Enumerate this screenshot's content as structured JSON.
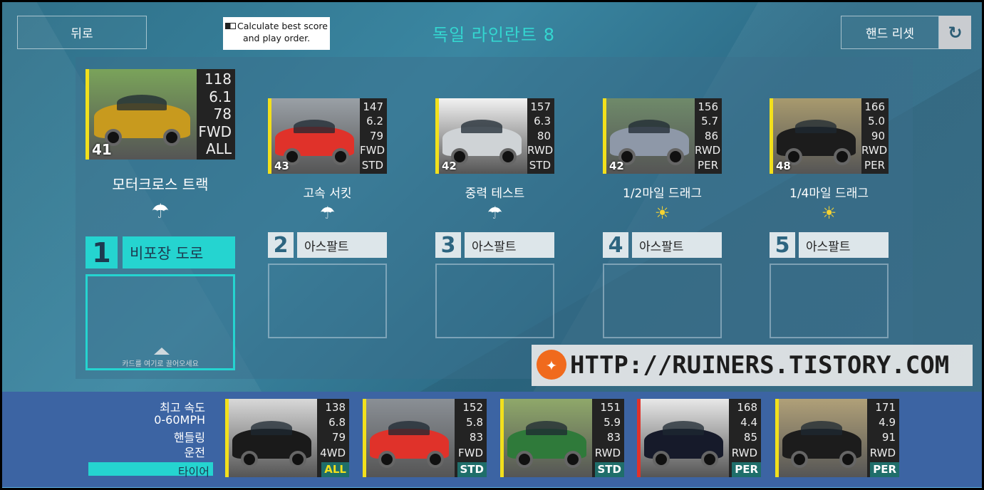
{
  "header": {
    "back_label": "뒤로",
    "calc_label": "Calculate best score and play order.",
    "title": "독일 라인란트 8",
    "reset_label": "핸드 리셋"
  },
  "events": [
    {
      "num": "1",
      "name": "모터크로스 트랙",
      "weather": "rain",
      "surface": "비포장 도로",
      "drop_hint": "카드를 여기로 끌어오세요",
      "card": {
        "rq": "41",
        "stats": [
          "118",
          "6.1",
          "78",
          "FWD",
          "ALL"
        ],
        "color": "#c89a1e",
        "bg": "#7aa35a"
      }
    },
    {
      "num": "2",
      "name": "고속 서킷",
      "weather": "rain",
      "surface": "아스팔트",
      "card": {
        "rq": "43",
        "stats": [
          "147",
          "6.2",
          "79",
          "FWD",
          "STD"
        ],
        "color": "#e0322a",
        "bg": "#9aa0a6"
      }
    },
    {
      "num": "3",
      "name": "중력 테스트",
      "weather": "rain",
      "surface": "아스팔트",
      "card": {
        "rq": "42",
        "stats": [
          "157",
          "6.3",
          "80",
          "RWD",
          "STD"
        ],
        "color": "#cfd3d6",
        "bg": "#f2f2f2"
      }
    },
    {
      "num": "4",
      "name": "1/2마일 드래그",
      "weather": "sun",
      "surface": "아스팔트",
      "card": {
        "rq": "42",
        "stats": [
          "156",
          "5.7",
          "86",
          "RWD",
          "PER"
        ],
        "color": "#8e98a8",
        "bg": "#6f8a6a"
      }
    },
    {
      "num": "5",
      "name": "1/4마일 드래그",
      "weather": "sun",
      "surface": "아스팔트",
      "card": {
        "rq": "48",
        "stats": [
          "166",
          "5.0",
          "90",
          "RWD",
          "PER"
        ],
        "color": "#1c1c1c",
        "bg": "#a89a6e"
      }
    }
  ],
  "legend": {
    "items": [
      "최고 속도",
      "0-60MPH",
      "핸들링",
      "운전",
      "타이어"
    ],
    "selected": "타이어"
  },
  "hand": [
    {
      "stats": [
        "138",
        "6.8",
        "79",
        "4WD"
      ],
      "tag": "ALL",
      "tag_color": "#1f6e6a",
      "tag_text": "#f2e01c",
      "stripe": "#f2e01c",
      "color": "#1a1a1a",
      "bg": "#d8d8d8"
    },
    {
      "stats": [
        "152",
        "5.8",
        "83",
        "FWD"
      ],
      "tag": "STD",
      "tag_color": "#1f6e6a",
      "tag_text": "#fff",
      "stripe": "#f2e01c",
      "color": "#e0322a",
      "bg": "#8a8f95"
    },
    {
      "stats": [
        "151",
        "5.9",
        "83",
        "RWD"
      ],
      "tag": "STD",
      "tag_color": "#1f6e6a",
      "tag_text": "#fff",
      "stripe": "#f2e01c",
      "color": "#2f7a3a",
      "bg": "#8fa86a"
    },
    {
      "stats": [
        "168",
        "4.4",
        "85",
        "RWD"
      ],
      "tag": "PER",
      "tag_color": "#1f6e6a",
      "tag_text": "#fff",
      "stripe": "#e0322a",
      "color": "#161a2a",
      "bg": "#e8e8e8"
    },
    {
      "stats": [
        "171",
        "4.9",
        "91",
        "RWD"
      ],
      "tag": "PER",
      "tag_color": "#1f6e6a",
      "tag_text": "#fff",
      "stripe": "#f2e01c",
      "color": "#1c1c1c",
      "bg": "#b0a078"
    }
  ],
  "watermark": "HTTP://RUINERS.TISTORY.COM"
}
